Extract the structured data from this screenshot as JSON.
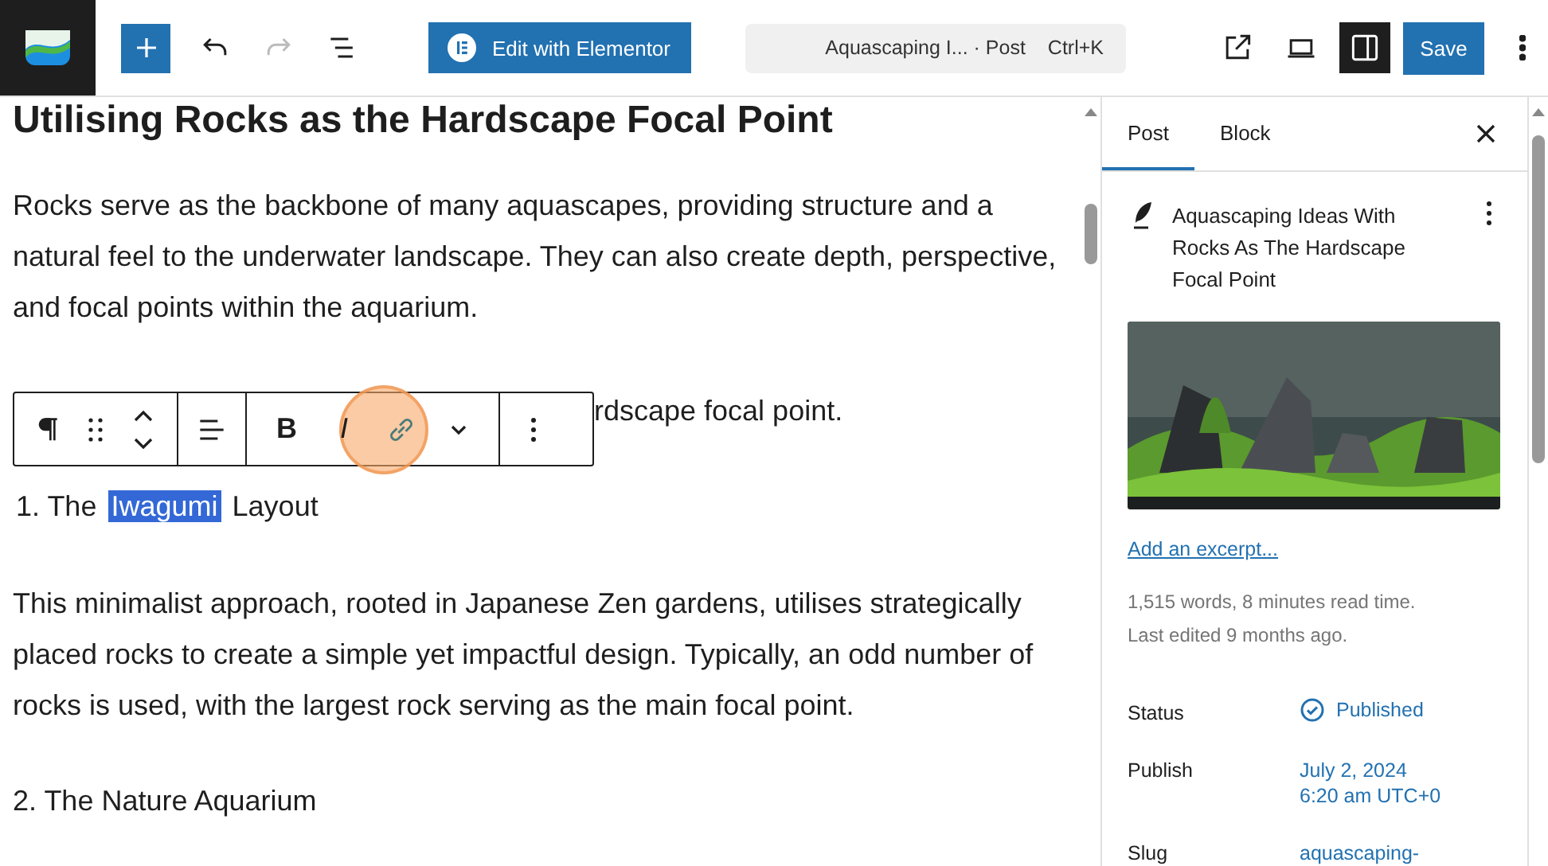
{
  "topbar": {
    "add_disabled": false,
    "undo_disabled": false,
    "redo_disabled": true,
    "elementor_button": "Edit with Elementor",
    "command_bar": {
      "title": "Aquascaping I... · Post",
      "shortcut": "Ctrl+K"
    },
    "settings_pressed": true,
    "save": "Save"
  },
  "editor": {
    "heading": "Utilising Rocks as the Hardscape Focal Point",
    "paragraph_1": "Rocks serve as the backbone of many aquascapes, providing structure and a natural feel to the underwater landscape. They can also create depth, perspective, and focal points within the aquarium.",
    "paragraph_partial": "rdscape focal point.",
    "list_item_1": [
      {
        "text": "1. The",
        "selected": false
      },
      {
        "text": "Iwagumi",
        "selected": true
      },
      {
        "text": "Layout",
        "selected": false
      }
    ],
    "paragraph_2": "This minimalist approach, rooted in Japanese Zen gardens, utilises strategically placed rocks to create a simple yet impactful design. Typically, an odd number of rocks is used, with the largest rock serving as the main focal point.",
    "list_item_2": "2. The Nature Aquarium",
    "toolbar": {
      "bold": "B",
      "italic": "I",
      "link_highlighted": true
    }
  },
  "sidebar": {
    "tabs": [
      {
        "label": "Post",
        "selected": true
      },
      {
        "label": "Block",
        "selected": false
      }
    ],
    "post_title": "Aquascaping Ideas With Rocks As The Hardscape Focal Point",
    "featured_image": {
      "kind": "picture"
    },
    "excerpt_link": "Add an excerpt...",
    "meta": [
      "1,515 words, 8 minutes read time.",
      "Last edited 9 months ago."
    ],
    "fields": [
      {
        "label": "Status",
        "kind": "status",
        "value": [
          "Published"
        ]
      },
      {
        "label": "Publish",
        "kind": "text",
        "value": [
          "July 2, 2024",
          "6:20 am UTC+0"
        ]
      },
      {
        "label": "Slug",
        "kind": "text",
        "value": [
          "aquascaping-"
        ]
      }
    ]
  }
}
